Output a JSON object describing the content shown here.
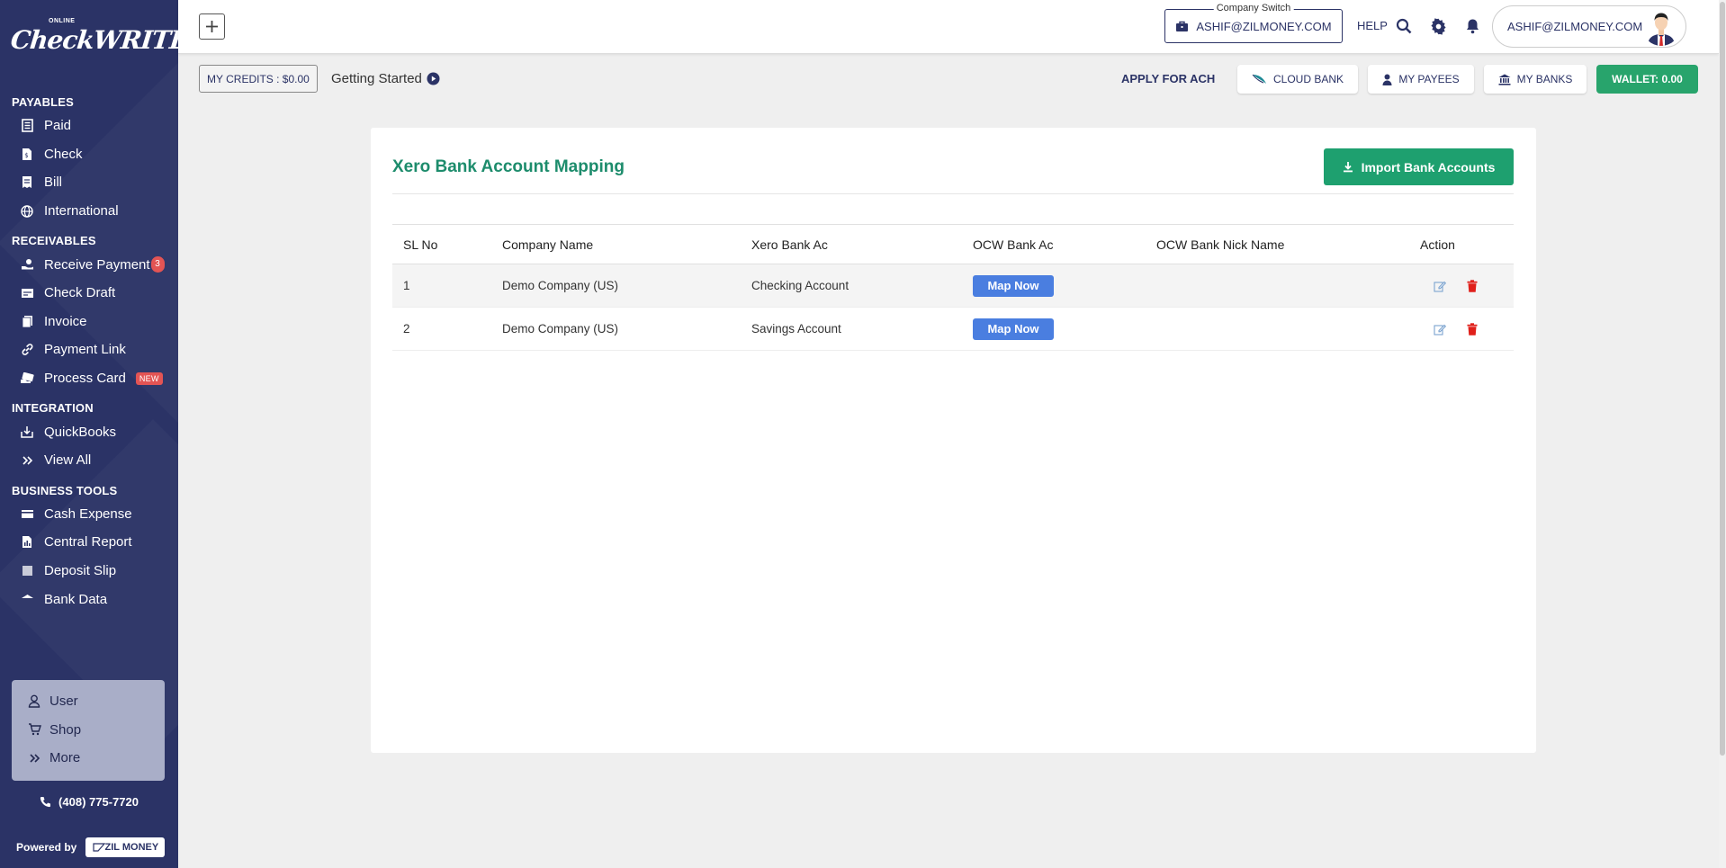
{
  "sidebar": {
    "logo": {
      "small": "ONLINE",
      "big": "CheckWRITER"
    },
    "sections": [
      {
        "title": "PAYABLES",
        "items": [
          {
            "label": "Paid",
            "icon": "receipt-icon"
          },
          {
            "label": "Check",
            "icon": "check-doc-icon"
          },
          {
            "label": "Bill",
            "icon": "bill-icon"
          },
          {
            "label": "International",
            "icon": "globe-icon"
          }
        ]
      },
      {
        "title": "RECEIVABLES",
        "items": [
          {
            "label": "Receive Payment",
            "icon": "hand-money-icon",
            "badge": "3"
          },
          {
            "label": "Check Draft",
            "icon": "check-draft-icon"
          },
          {
            "label": "Invoice",
            "icon": "invoice-icon"
          },
          {
            "label": "Payment Link",
            "icon": "link-icon"
          },
          {
            "label": "Process Card",
            "icon": "card-icon",
            "tag": "NEW"
          }
        ]
      },
      {
        "title": "INTEGRATION",
        "items": [
          {
            "label": "QuickBooks",
            "icon": "download-box-icon"
          },
          {
            "label": "View All",
            "icon": "double-chevron-icon"
          }
        ]
      },
      {
        "title": "BUSINESS TOOLS",
        "items": [
          {
            "label": "Cash Expense",
            "icon": "cash-icon"
          },
          {
            "label": "Central Report",
            "icon": "report-icon"
          },
          {
            "label": "Deposit Slip",
            "icon": "slip-icon"
          },
          {
            "label": "Bank Data",
            "icon": "bank-data-icon"
          }
        ]
      }
    ],
    "bottom": [
      {
        "label": "User",
        "icon": "user-icon"
      },
      {
        "label": "Shop",
        "icon": "cart-icon"
      },
      {
        "label": "More",
        "icon": "double-chevron-icon"
      }
    ],
    "phone": "(408) 775-7720",
    "powered_by": "Powered by",
    "zil_logo": "ZIL MONEY"
  },
  "topbar": {
    "company_switch_legend": "Company Switch",
    "company_email": "ASHIF@ZILMONEY.COM",
    "help": "HELP",
    "user_email": "ASHIF@ZILMONEY.COM"
  },
  "subbar": {
    "credits": "MY CREDITS : $0.00",
    "getting_started": "Getting Started",
    "apply_ach": "APPLY FOR ACH",
    "cloud_bank": "CLOUD BANK",
    "my_payees": "MY PAYEES",
    "my_banks": "MY BANKS",
    "wallet": "WALLET: 0.00"
  },
  "main": {
    "title": "Xero Bank Account Mapping",
    "import_button": "Import Bank Accounts",
    "columns": [
      "SL No",
      "Company Name",
      "Xero Bank Ac",
      "OCW Bank Ac",
      "OCW Bank Nick Name",
      "Action"
    ],
    "rows": [
      {
        "sl": "1",
        "company": "Demo Company (US)",
        "xero": "Checking Account",
        "ocw_button": "Map Now",
        "nick": ""
      },
      {
        "sl": "2",
        "company": "Demo Company (US)",
        "xero": "Savings Account",
        "ocw_button": "Map Now",
        "nick": ""
      }
    ]
  },
  "colors": {
    "sidebar": "#2b3366",
    "accent_green": "#1ea06f",
    "title_green": "#1d8c6c",
    "map_blue": "#4a7ee0",
    "delete_red": "#e0201b"
  }
}
